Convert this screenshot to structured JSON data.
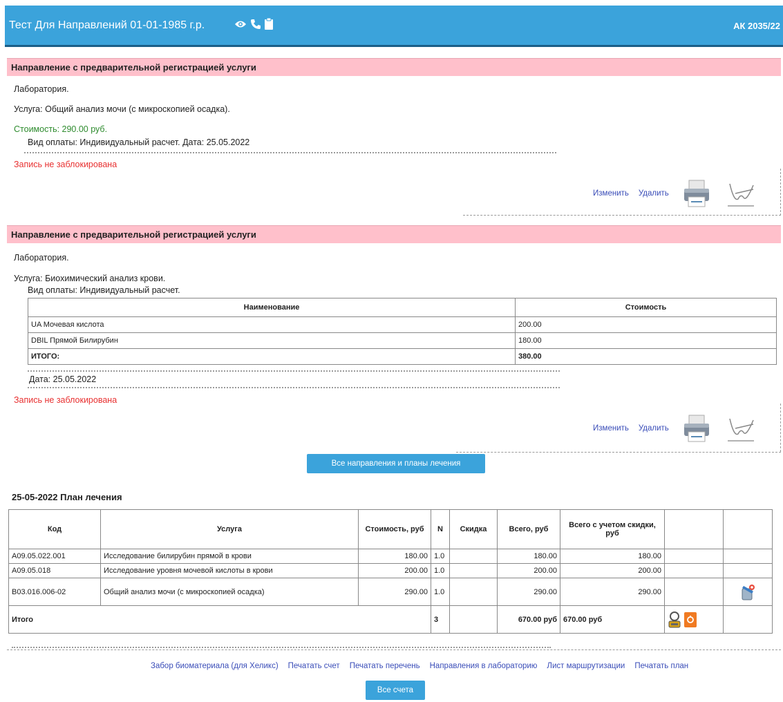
{
  "header": {
    "title": "Тест Для Направлений 01-01-1985 г.р.",
    "right_code": "АК 2035/22",
    "icons": [
      "eye-icon",
      "phone-icon",
      "clipboard-icon"
    ]
  },
  "directions": [
    {
      "header": "Направление с предварительной регистрацией услуги",
      "department": "Лаборатория.",
      "service_label": "Услуга:",
      "service": "Общий анализ мочи (с микроскопией осадка).",
      "cost_text": "Стоимость: 290.00 руб.",
      "payment": "Вид оплаты: Индивидуальный расчет. Дата: 25.05.2022",
      "status": "Запись не заблокирована",
      "edit_label": "Изменить",
      "delete_label": "Удалить"
    },
    {
      "header": "Направление с предварительной регистрацией услуги",
      "department": "Лаборатория.",
      "service_label": "Услуга:",
      "service": "Биохимический анализ крови.",
      "payment": "Вид оплаты: Индивидуальный расчет.",
      "table": {
        "col_name": "Наименование",
        "col_cost": "Стоимость",
        "rows": [
          {
            "name": "UA Мочевая кислота",
            "cost": "200.00"
          },
          {
            "name": "DBIL Прямой Билирубин",
            "cost": "180.00"
          }
        ],
        "total_label": "ИТОГО:",
        "total": "380.00"
      },
      "date": "Дата: 25.05.2022",
      "status": "Запись не заблокирована",
      "edit_label": "Изменить",
      "delete_label": "Удалить"
    }
  ],
  "all_directions_button": "Все направления и планы лечения",
  "plan": {
    "title": "25-05-2022 План лечения",
    "columns": [
      "Код",
      "Услуга",
      "Стоимость, руб",
      "N",
      "Скидка",
      "Всего, руб",
      "Всего с учетом скидки, руб",
      "",
      ""
    ],
    "rows": [
      {
        "code": "A09.05.022.001",
        "service": "Исследование билирубин прямой в крови",
        "cost": "180.00",
        "n": "1.0",
        "discount": "",
        "total": "180.00",
        "total_disc": "180.00"
      },
      {
        "code": "A09.05.018",
        "service": "Исследование уровня мочевой кислоты в крови",
        "cost": "200.00",
        "n": "1.0",
        "discount": "",
        "total": "200.00",
        "total_disc": "200.00"
      },
      {
        "code": "B03.016.006-02",
        "service": "Общий анализ мочи (с микроскопией осадка)",
        "cost": "290.00",
        "n": "1.0",
        "discount": "",
        "total": "290.00",
        "total_disc": "290.00"
      }
    ],
    "total_label": "Итого",
    "total_n": "3",
    "total_sum": "670.00 руб",
    "total_disc_sum": "670.00 руб"
  },
  "bottom_links": [
    "Забор биоматериала (для Хеликс)",
    "Печатать счет",
    "Печатать перечень",
    "Направления в лабораторию",
    "Лист маршрутизации",
    "Печатать план"
  ],
  "all_bills_button": "Все счета"
}
